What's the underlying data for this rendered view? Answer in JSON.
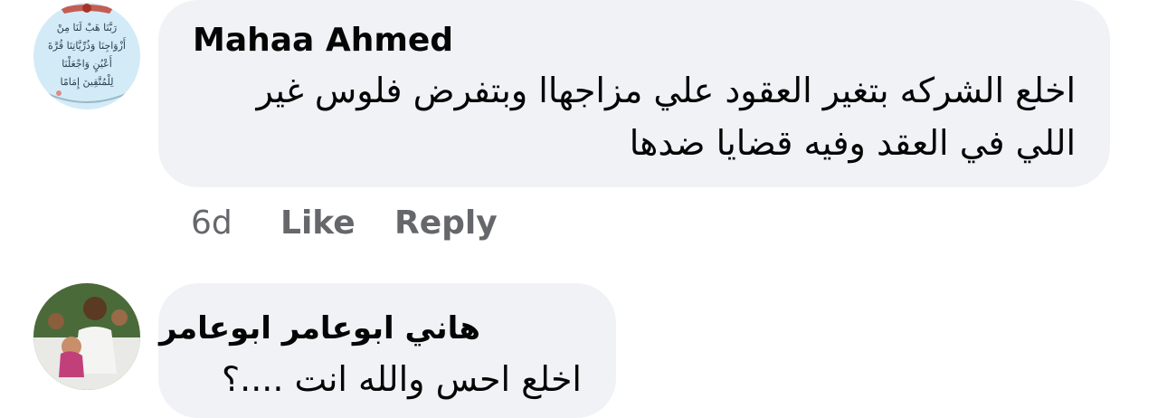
{
  "comments": [
    {
      "author": "Mahaa Ahmed",
      "text_lines": [
        "اخلع الشركه بتغير العقود علي مزاجهاا وبتفرض فلوس غير",
        "اللي في العقد وفيه قضايا ضدها"
      ],
      "avatar_text_lines": [
        "رَبَّنَا هَبْ لَنَا مِنْ",
        "أَزْوَاجِنَا وَذُرِّيَّاتِنَا قُرَّةَ",
        "أَعْيُنٍ وَاجْعَلْنَا",
        "لِلْمُتَّقِينَ إِمَامًا"
      ],
      "time": "6d",
      "like_label": "Like",
      "reply_label": "Reply"
    },
    {
      "author": "هاني ابوعامر ابوعامر",
      "text_lines": [
        "اخلع احس والله انت ....؟"
      ]
    }
  ],
  "colors": {
    "bubble": "#f0f2f5",
    "text": "#050505",
    "secondary": "#65676b"
  }
}
